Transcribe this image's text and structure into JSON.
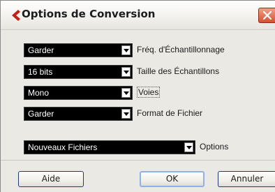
{
  "window": {
    "title": "Options de Conversion"
  },
  "fields": [
    {
      "value": "Garder",
      "label": "Fréq. d'Échantillonnage"
    },
    {
      "value": "16 bits",
      "label": "Taille des Échantillons"
    },
    {
      "value": "Mono",
      "label": "Voies"
    },
    {
      "value": "Garder",
      "label": "Format de Fichier"
    },
    {
      "value": "Nouveaux Fichiers",
      "label": "Options"
    }
  ],
  "buttons": {
    "help": "Aide",
    "ok": "OK",
    "cancel": "Annuler"
  },
  "icons": {
    "app": "cubase-logo-icon",
    "close": "close-icon",
    "dropdown": "chevron-down-icon"
  },
  "colors": {
    "app_icon": "#c0201a",
    "close_button": "#d4522f",
    "dropdown_background": "#000000",
    "dropdown_text": "#ffffff",
    "dialog_background": "#ebe9e4"
  }
}
